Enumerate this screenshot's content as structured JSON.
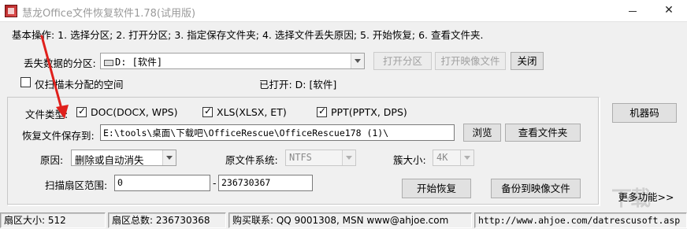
{
  "window": {
    "title": "慧龙Office文件恢复软件1.78(试用版)"
  },
  "steps_text": "基本操作: 1. 选择分区; 2. 打开分区; 3. 指定保存文件夹; 4. 选择文件丢失原因; 5. 开始恢复; 6. 查看文件夹.",
  "partition": {
    "label": "丢失数据的分区:",
    "selected": "D: [软件]",
    "open_button": "打开分区",
    "open_image_button": "打开映像文件",
    "close_button": "关闭",
    "unallocated_label": "仅扫描未分配的空间",
    "unallocated_checked": false,
    "opened_label": "已打开: D: [软件]"
  },
  "file_types": {
    "label": "文件类型:",
    "items": [
      {
        "label": "DOC(DOCX, WPS)",
        "checked": true
      },
      {
        "label": "XLS(XLSX, ET)",
        "checked": true
      },
      {
        "label": "PPT(PPTX, DPS)",
        "checked": true
      }
    ]
  },
  "save_to": {
    "label": "恢复文件保存到:",
    "path": "E:\\tools\\桌面\\下载吧\\OfficeRescue\\OfficeRescue178 (1)\\",
    "browse_button": "浏览",
    "view_folder_button": "查看文件夹"
  },
  "reason": {
    "label": "原因:",
    "selected": "删除或自动消失"
  },
  "fs": {
    "label": "原文件系统:",
    "selected": "NTFS"
  },
  "cluster": {
    "label": "簇大小:",
    "selected": "4K"
  },
  "scan_range": {
    "label": "扫描扇区范围:",
    "start": "0",
    "separator": "-",
    "end": "236730367"
  },
  "actions": {
    "start_button": "开始恢复",
    "backup_button": "备份到映像文件",
    "machine_code_button": "机器码",
    "more_button": "更多功能>>"
  },
  "status_bar": {
    "sector_size": "扇区大小: 512",
    "sector_total": "扇区总数: 236730368",
    "contact": "购买联系: QQ 9001308, MSN www@ahjoe.com",
    "url": "http://www.ahjoe.com/datrescusoft.asp"
  },
  "colors": {
    "annotation_arrow": "#e0201c"
  }
}
